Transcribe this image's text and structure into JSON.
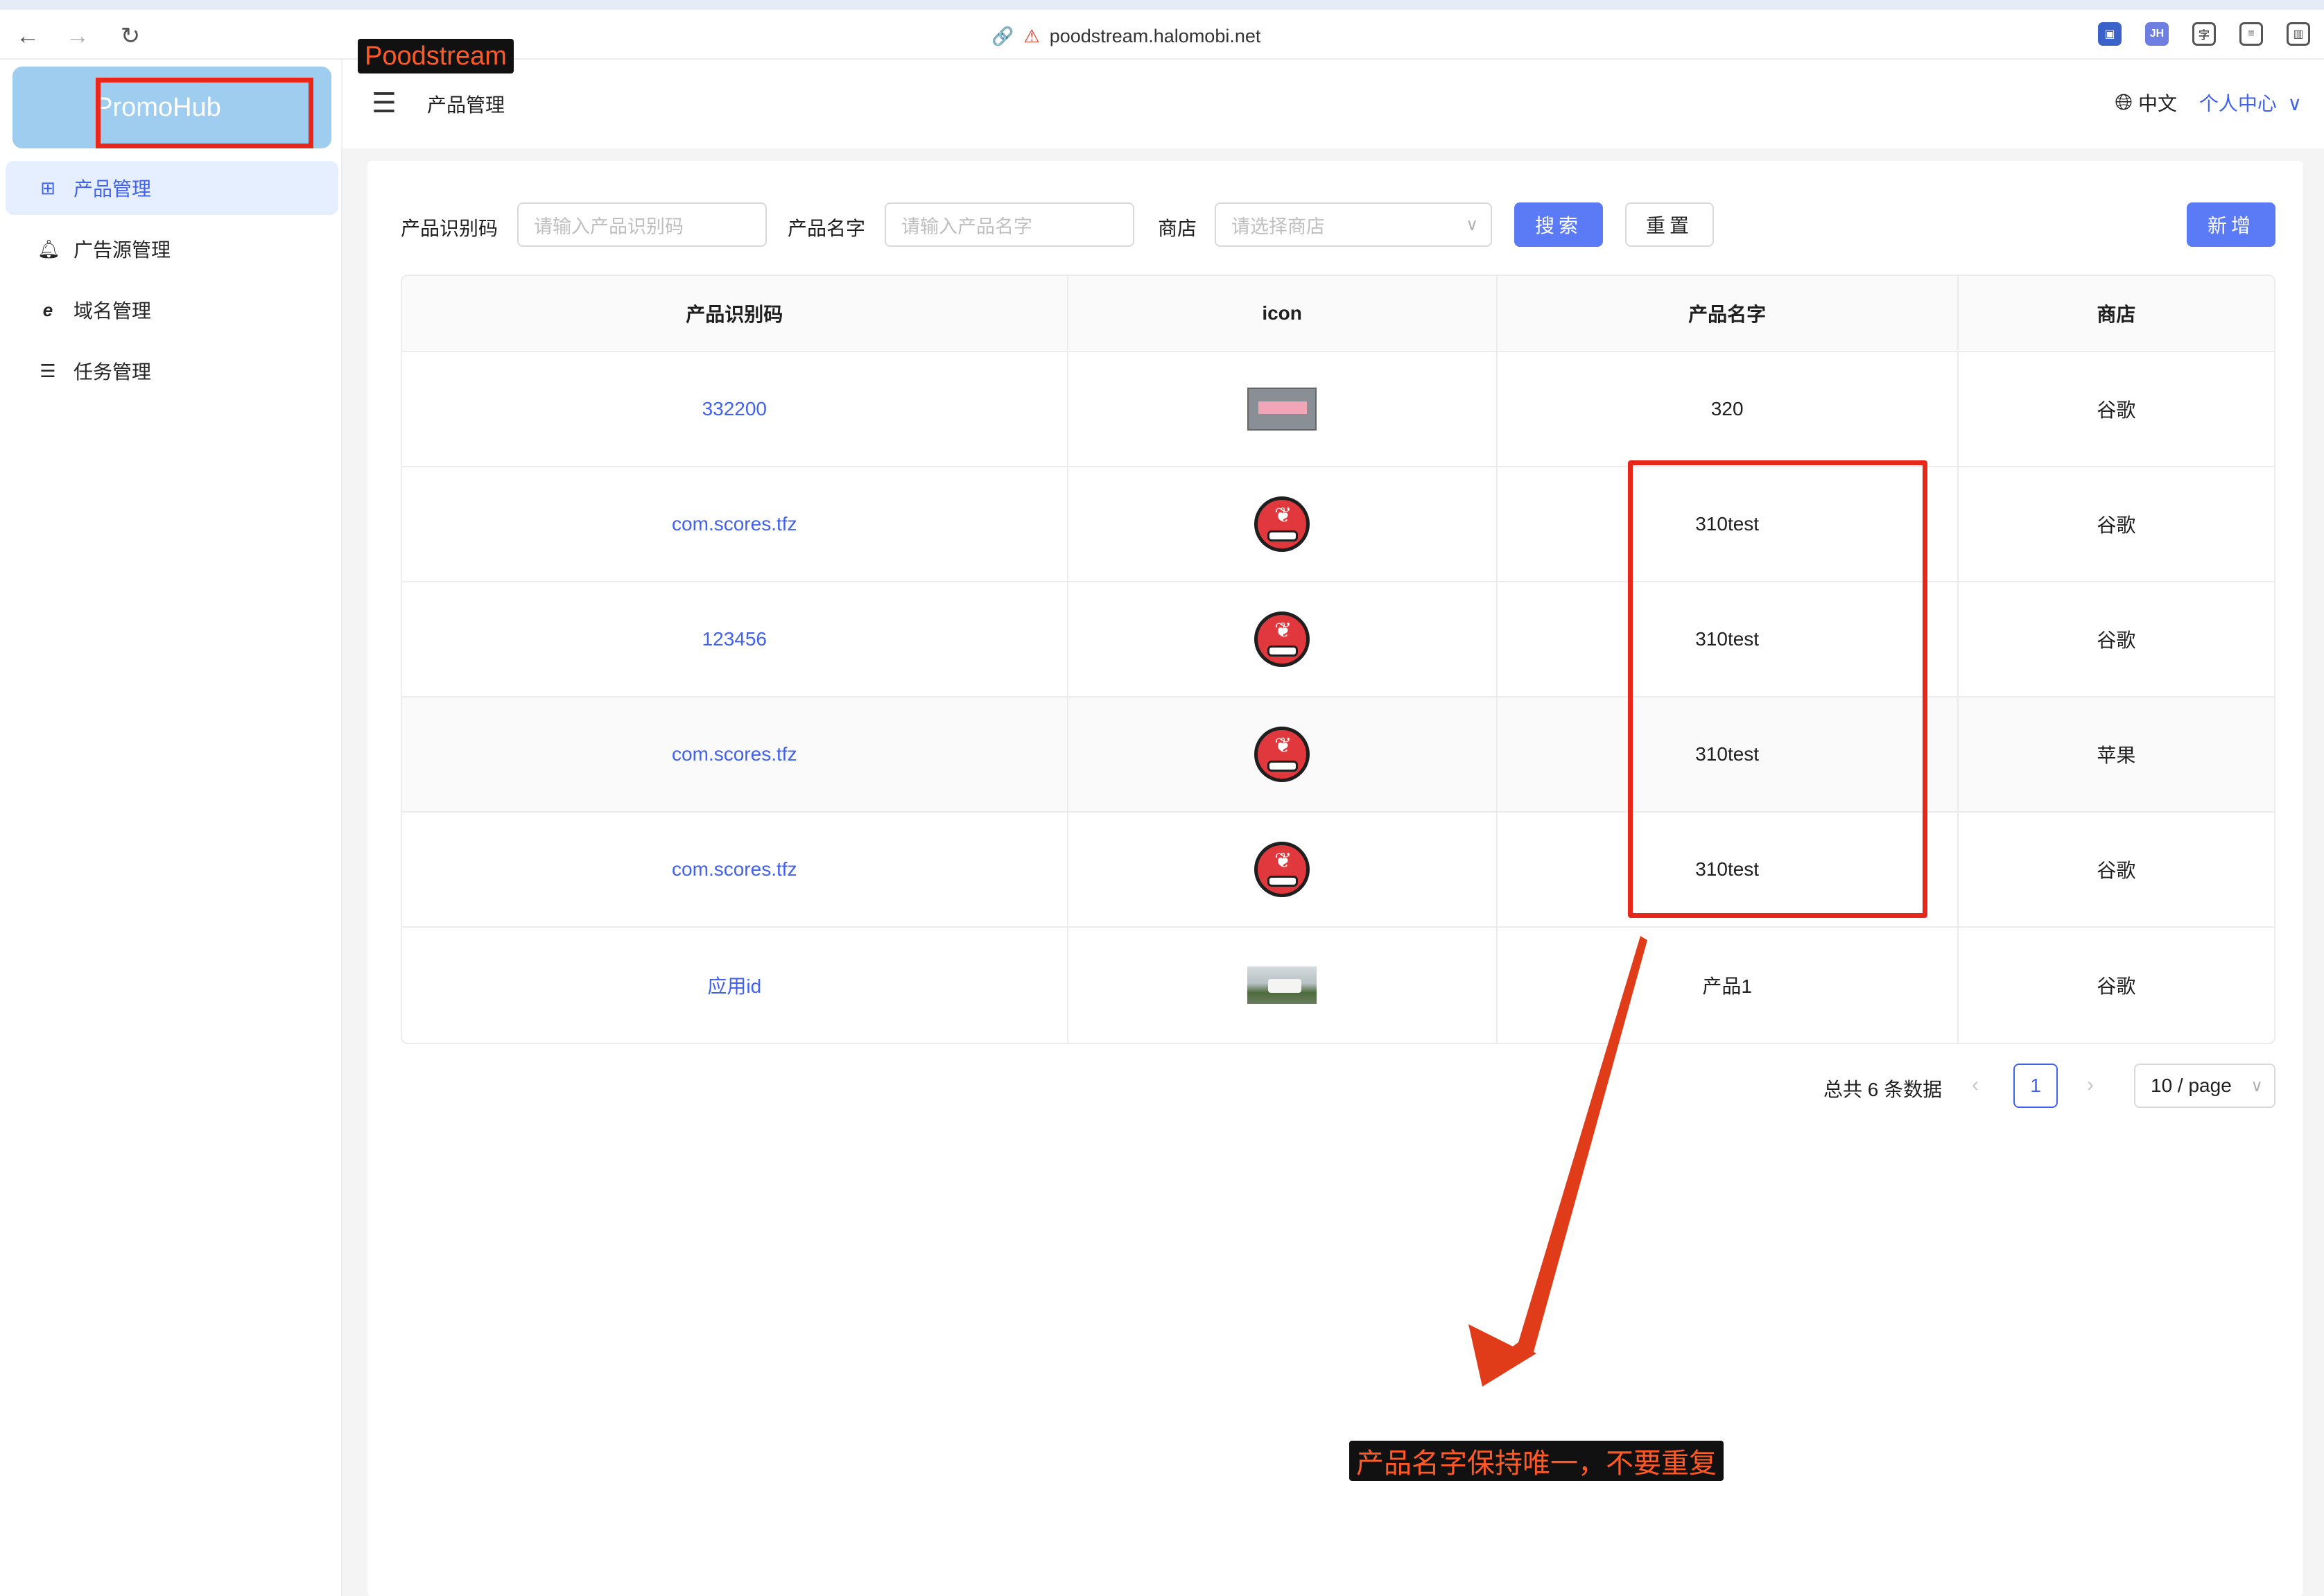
{
  "browser": {
    "url": "poodstream.halomobi.net",
    "extensions": [
      "JH"
    ]
  },
  "annotation": {
    "app_tag": "Poodstream",
    "note": "产品名字保持唯一，不要重复",
    "color": "#e8261a"
  },
  "sidebar": {
    "logo": "PromoHub",
    "items": [
      {
        "label": "产品管理",
        "icon": "grid-icon",
        "active": true
      },
      {
        "label": "广告源管理",
        "icon": "bell-icon",
        "active": false
      },
      {
        "label": "域名管理",
        "icon": "ie-icon",
        "active": false
      },
      {
        "label": "任务管理",
        "icon": "list-icon",
        "active": false
      }
    ]
  },
  "header": {
    "title": "产品管理",
    "language": "中文",
    "user_menu": "个人中心"
  },
  "search": {
    "product_id_label": "产品识别码",
    "product_id_placeholder": "请输入产品识别码",
    "product_name_label": "产品名字",
    "product_name_placeholder": "请输入产品名字",
    "store_label": "商店",
    "store_placeholder": "请选择商店",
    "search_button": "搜索",
    "reset_button": "重置",
    "add_button": "新增"
  },
  "table": {
    "columns": [
      "产品识别码",
      "icon",
      "产品名字",
      "商店"
    ],
    "rows": [
      {
        "id": "332200",
        "icon": "banner-thumbnail",
        "name": "320",
        "store": "谷歌"
      },
      {
        "id": "com.scores.tfz",
        "icon": "cherry-car-icon",
        "name": "310test",
        "store": "谷歌"
      },
      {
        "id": "123456",
        "icon": "cherry-car-icon",
        "name": "310test",
        "store": "谷歌"
      },
      {
        "id": "com.scores.tfz",
        "icon": "cherry-car-icon",
        "name": "310test",
        "store": "苹果"
      },
      {
        "id": "com.scores.tfz",
        "icon": "cherry-car-icon",
        "name": "310test",
        "store": "谷歌"
      },
      {
        "id": "应用id",
        "icon": "car-photo-thumbnail",
        "name": "产品1",
        "store": "谷歌"
      }
    ]
  },
  "pagination": {
    "total": "总共 6 条数据",
    "current_page": "1",
    "page_size": "10 / page"
  }
}
